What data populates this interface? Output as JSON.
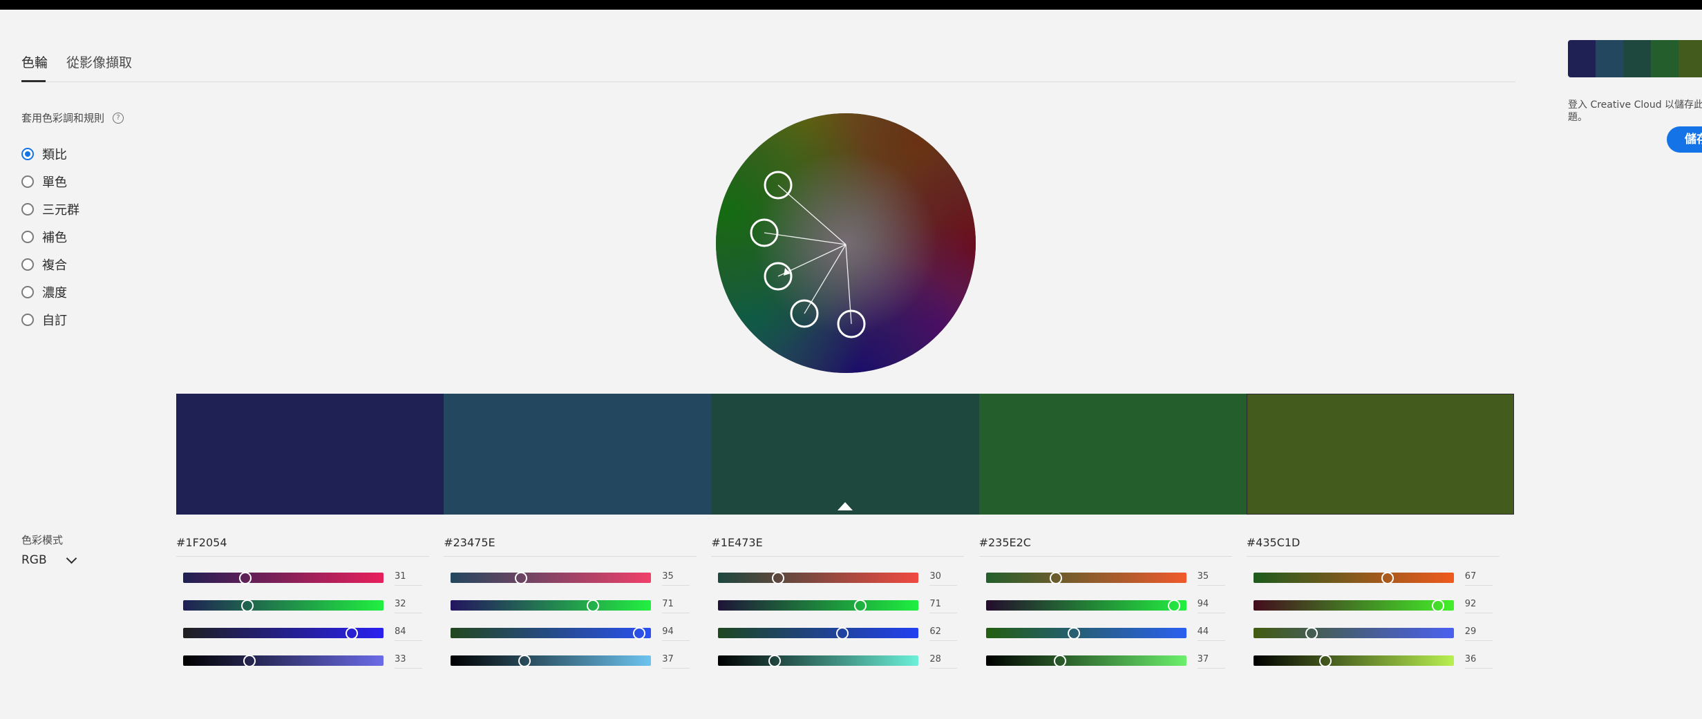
{
  "tabs": [
    {
      "label": "色輪",
      "active": true
    },
    {
      "label": "從影像擷取",
      "active": false
    }
  ],
  "harmony": {
    "heading": "套用色彩調和規則",
    "rules": [
      {
        "label": "類比",
        "selected": true
      },
      {
        "label": "單色",
        "selected": false
      },
      {
        "label": "三元群",
        "selected": false
      },
      {
        "label": "補色",
        "selected": false
      },
      {
        "label": "複合",
        "selected": false
      },
      {
        "label": "濃度",
        "selected": false
      },
      {
        "label": "自訂",
        "selected": false
      }
    ]
  },
  "color_mode": {
    "label": "色彩模式",
    "value": "RGB"
  },
  "theme_colors": [
    "#1F2054",
    "#23475E",
    "#1E473E",
    "#235E2C",
    "#435C1D"
  ],
  "base_color_index": 2,
  "editors": [
    {
      "hex": "#1F2054",
      "values": [
        31,
        32,
        84,
        33
      ]
    },
    {
      "hex": "#23475E",
      "values": [
        35,
        71,
        94,
        37
      ]
    },
    {
      "hex": "#1E473E",
      "values": [
        30,
        71,
        62,
        28
      ]
    },
    {
      "hex": "#235E2C",
      "values": [
        35,
        94,
        44,
        37
      ]
    },
    {
      "hex": "#435C1D",
      "values": [
        67,
        92,
        29,
        36
      ]
    }
  ],
  "right_panel": {
    "signin_line1": "登入 Creative Cloud 以儲存此色",
    "signin_line2": "題。",
    "save_label": "儲存"
  }
}
